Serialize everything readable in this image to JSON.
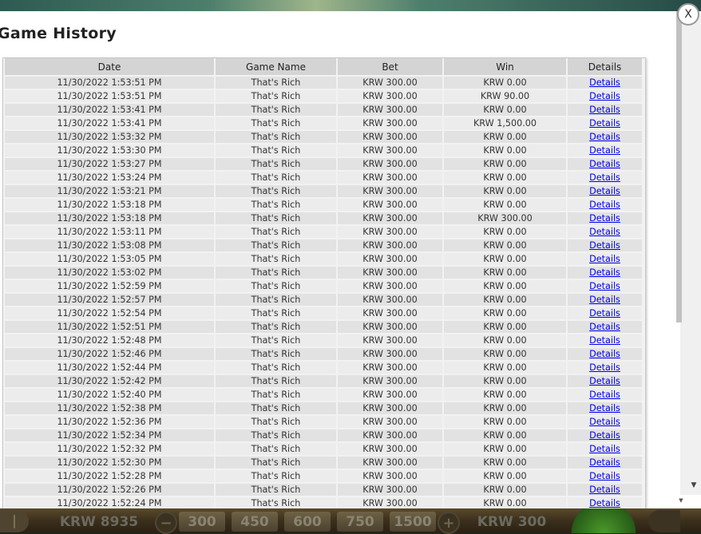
{
  "game_bar": {
    "balance": "KRW 8935",
    "bet_options": [
      "300",
      "450",
      "600",
      "750",
      "1500"
    ],
    "decrease_symbol": "−",
    "increase_symbol": "+",
    "current_bet": "KRW 300"
  },
  "modal": {
    "title": "Game History",
    "close_symbol": "X"
  },
  "table": {
    "headers": {
      "date": "Date",
      "game_name": "Game Name",
      "bet": "Bet",
      "win": "Win",
      "details": "Details"
    },
    "rows": [
      {
        "date": "11/30/2022 1:53:51 PM",
        "game": "That's Rich",
        "bet": "KRW 300.00",
        "win": "KRW 0.00",
        "details": "Details"
      },
      {
        "date": "11/30/2022 1:53:51 PM",
        "game": "That's Rich",
        "bet": "KRW 300.00",
        "win": "KRW 90.00",
        "details": "Details"
      },
      {
        "date": "11/30/2022 1:53:41 PM",
        "game": "That's Rich",
        "bet": "KRW 300.00",
        "win": "KRW 0.00",
        "details": "Details"
      },
      {
        "date": "11/30/2022 1:53:41 PM",
        "game": "That's Rich",
        "bet": "KRW 300.00",
        "win": "KRW 1,500.00",
        "details": "Details"
      },
      {
        "date": "11/30/2022 1:53:32 PM",
        "game": "That's Rich",
        "bet": "KRW 300.00",
        "win": "KRW 0.00",
        "details": "Details"
      },
      {
        "date": "11/30/2022 1:53:30 PM",
        "game": "That's Rich",
        "bet": "KRW 300.00",
        "win": "KRW 0.00",
        "details": "Details"
      },
      {
        "date": "11/30/2022 1:53:27 PM",
        "game": "That's Rich",
        "bet": "KRW 300.00",
        "win": "KRW 0.00",
        "details": "Details"
      },
      {
        "date": "11/30/2022 1:53:24 PM",
        "game": "That's Rich",
        "bet": "KRW 300.00",
        "win": "KRW 0.00",
        "details": "Details"
      },
      {
        "date": "11/30/2022 1:53:21 PM",
        "game": "That's Rich",
        "bet": "KRW 300.00",
        "win": "KRW 0.00",
        "details": "Details"
      },
      {
        "date": "11/30/2022 1:53:18 PM",
        "game": "That's Rich",
        "bet": "KRW 300.00",
        "win": "KRW 0.00",
        "details": "Details"
      },
      {
        "date": "11/30/2022 1:53:18 PM",
        "game": "That's Rich",
        "bet": "KRW 300.00",
        "win": "KRW 300.00",
        "details": "Details"
      },
      {
        "date": "11/30/2022 1:53:11 PM",
        "game": "That's Rich",
        "bet": "KRW 300.00",
        "win": "KRW 0.00",
        "details": "Details"
      },
      {
        "date": "11/30/2022 1:53:08 PM",
        "game": "That's Rich",
        "bet": "KRW 300.00",
        "win": "KRW 0.00",
        "details": "Details"
      },
      {
        "date": "11/30/2022 1:53:05 PM",
        "game": "That's Rich",
        "bet": "KRW 300.00",
        "win": "KRW 0.00",
        "details": "Details"
      },
      {
        "date": "11/30/2022 1:53:02 PM",
        "game": "That's Rich",
        "bet": "KRW 300.00",
        "win": "KRW 0.00",
        "details": "Details"
      },
      {
        "date": "11/30/2022 1:52:59 PM",
        "game": "That's Rich",
        "bet": "KRW 300.00",
        "win": "KRW 0.00",
        "details": "Details"
      },
      {
        "date": "11/30/2022 1:52:57 PM",
        "game": "That's Rich",
        "bet": "KRW 300.00",
        "win": "KRW 0.00",
        "details": "Details"
      },
      {
        "date": "11/30/2022 1:52:54 PM",
        "game": "That's Rich",
        "bet": "KRW 300.00",
        "win": "KRW 0.00",
        "details": "Details"
      },
      {
        "date": "11/30/2022 1:52:51 PM",
        "game": "That's Rich",
        "bet": "KRW 300.00",
        "win": "KRW 0.00",
        "details": "Details"
      },
      {
        "date": "11/30/2022 1:52:48 PM",
        "game": "That's Rich",
        "bet": "KRW 300.00",
        "win": "KRW 0.00",
        "details": "Details"
      },
      {
        "date": "11/30/2022 1:52:46 PM",
        "game": "That's Rich",
        "bet": "KRW 300.00",
        "win": "KRW 0.00",
        "details": "Details"
      },
      {
        "date": "11/30/2022 1:52:44 PM",
        "game": "That's Rich",
        "bet": "KRW 300.00",
        "win": "KRW 0.00",
        "details": "Details"
      },
      {
        "date": "11/30/2022 1:52:42 PM",
        "game": "That's Rich",
        "bet": "KRW 300.00",
        "win": "KRW 0.00",
        "details": "Details"
      },
      {
        "date": "11/30/2022 1:52:40 PM",
        "game": "That's Rich",
        "bet": "KRW 300.00",
        "win": "KRW 0.00",
        "details": "Details"
      },
      {
        "date": "11/30/2022 1:52:38 PM",
        "game": "That's Rich",
        "bet": "KRW 300.00",
        "win": "KRW 0.00",
        "details": "Details"
      },
      {
        "date": "11/30/2022 1:52:36 PM",
        "game": "That's Rich",
        "bet": "KRW 300.00",
        "win": "KRW 0.00",
        "details": "Details"
      },
      {
        "date": "11/30/2022 1:52:34 PM",
        "game": "That's Rich",
        "bet": "KRW 300.00",
        "win": "KRW 0.00",
        "details": "Details"
      },
      {
        "date": "11/30/2022 1:52:32 PM",
        "game": "That's Rich",
        "bet": "KRW 300.00",
        "win": "KRW 0.00",
        "details": "Details"
      },
      {
        "date": "11/30/2022 1:52:30 PM",
        "game": "That's Rich",
        "bet": "KRW 300.00",
        "win": "KRW 0.00",
        "details": "Details"
      },
      {
        "date": "11/30/2022 1:52:28 PM",
        "game": "That's Rich",
        "bet": "KRW 300.00",
        "win": "KRW 0.00",
        "details": "Details"
      },
      {
        "date": "11/30/2022 1:52:26 PM",
        "game": "That's Rich",
        "bet": "KRW 300.00",
        "win": "KRW 0.00",
        "details": "Details"
      },
      {
        "date": "11/30/2022 1:52:24 PM",
        "game": "That's Rich",
        "bet": "KRW 300.00",
        "win": "KRW 0.00",
        "details": "Details"
      }
    ]
  }
}
